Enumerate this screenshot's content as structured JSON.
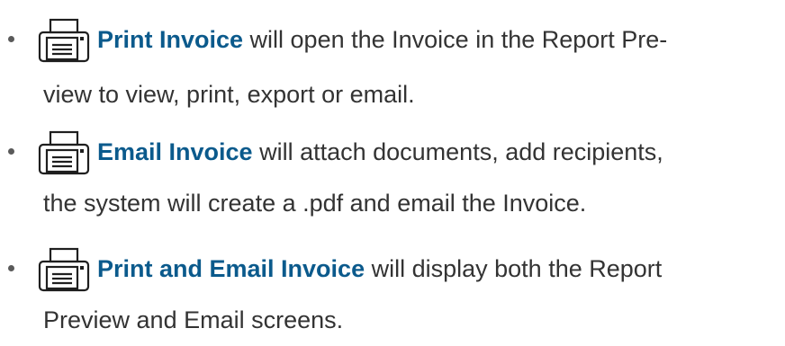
{
  "items": [
    {
      "icon": "printer-icon",
      "action_label": "Print Invoice",
      "description_line1": " will open the Invoice in the Report Pre-",
      "description_line2": "view to view, print, export or email."
    },
    {
      "icon": "printer-icon",
      "action_label": "Email Invoice",
      "description_line1": " will attach documents, add recipients,",
      "description_line2": "the system will create a .pdf and email the Invoice."
    },
    {
      "icon": "printer-icon",
      "action_label": "Print and Email Invoice",
      "description_line1": " will display both the Report",
      "description_line2": "Preview and Email screens."
    }
  ],
  "colors": {
    "action_text": "#0b5a8c",
    "body_text": "#333333",
    "icon_stroke": "#1f1f1f"
  }
}
